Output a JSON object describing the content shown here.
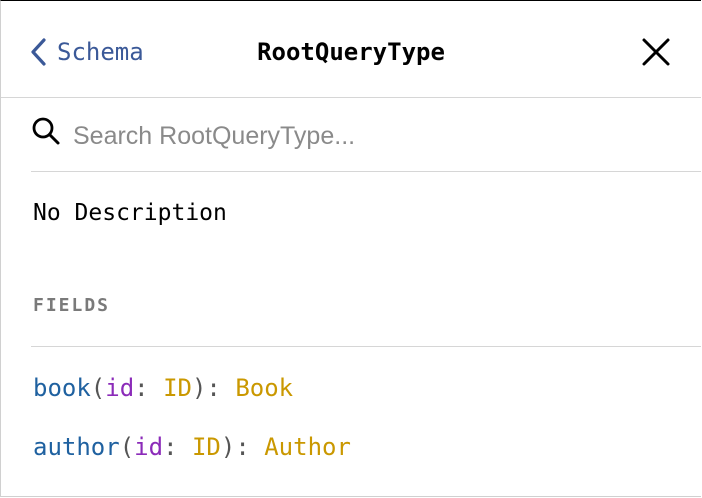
{
  "header": {
    "back_label": "Schema",
    "title": "RootQueryType",
    "close_icon": "close-icon",
    "back_icon": "chevron-left-icon"
  },
  "search": {
    "placeholder": "Search RootQueryType...",
    "value": ""
  },
  "description": "No Description",
  "fields_heading": "FIELDS",
  "fields": [
    {
      "name": "book",
      "arg_name": "id",
      "arg_type": "ID",
      "return_type": "Book"
    },
    {
      "name": "author",
      "arg_name": "id",
      "arg_type": "ID",
      "return_type": "Author"
    }
  ],
  "punctuation": {
    "open_paren": "(",
    "colon": ": ",
    "close_paren_colon": "): "
  },
  "colors": {
    "field_name": "#1f61a0",
    "arg_name": "#8b2bb9",
    "type_name": "#ca9800",
    "link": "#3b5998"
  }
}
